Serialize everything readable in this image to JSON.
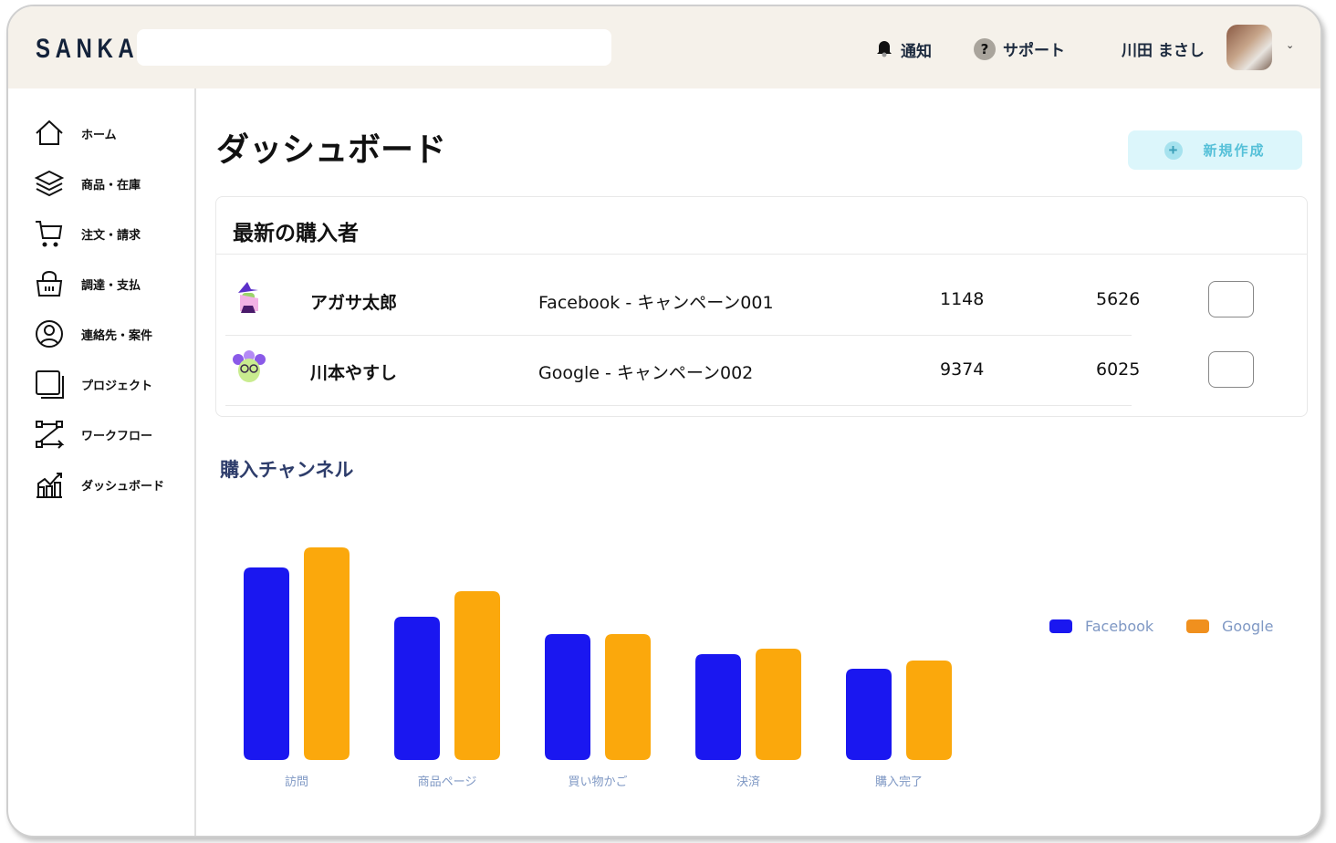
{
  "header": {
    "logo": "SANKA",
    "search_placeholder": "",
    "notify": "通知",
    "support": "サポート",
    "user": "川田 まさし"
  },
  "sidebar": {
    "items": [
      {
        "label": "ホーム",
        "icon": "home-icon"
      },
      {
        "label": "商品・在庫",
        "icon": "layers-icon"
      },
      {
        "label": "注文・請求",
        "icon": "cart-icon"
      },
      {
        "label": "調達・支払",
        "icon": "basket-icon"
      },
      {
        "label": "連絡先・案件",
        "icon": "user-circle-icon"
      },
      {
        "label": "プロジェクト",
        "icon": "project-icon"
      },
      {
        "label": "ワークフロー",
        "icon": "workflow-icon"
      },
      {
        "label": "ダッシュボード",
        "icon": "chart-icon"
      }
    ]
  },
  "main": {
    "title": "ダッシュボード",
    "new_button": "新規作成",
    "buyers": {
      "title": "最新の購入者",
      "rows": [
        {
          "name": "アガサ太郎",
          "campaign": "Facebook - キャンペーン001",
          "v1": "1148",
          "v2": "5626"
        },
        {
          "name": "川本やすし",
          "campaign": "Google - キャンペーン002",
          "v1": "9374",
          "v2": "6025"
        }
      ]
    }
  },
  "chart_data": {
    "type": "bar",
    "title": "購入チャンネル",
    "categories": [
      "訪問",
      "商品ページ",
      "買い物かご",
      "決済",
      "購入完了"
    ],
    "series": [
      {
        "name": "Facebook",
        "color": "#1a17f0",
        "values": [
          211,
          157,
          138,
          116,
          100
        ]
      },
      {
        "name": "Google",
        "color": "#fba80c",
        "values": [
          233,
          185,
          138,
          122,
          109
        ]
      }
    ],
    "ylim": [
      0,
      233
    ],
    "grid": false,
    "legend": "right",
    "xlabel": "",
    "ylabel": ""
  }
}
